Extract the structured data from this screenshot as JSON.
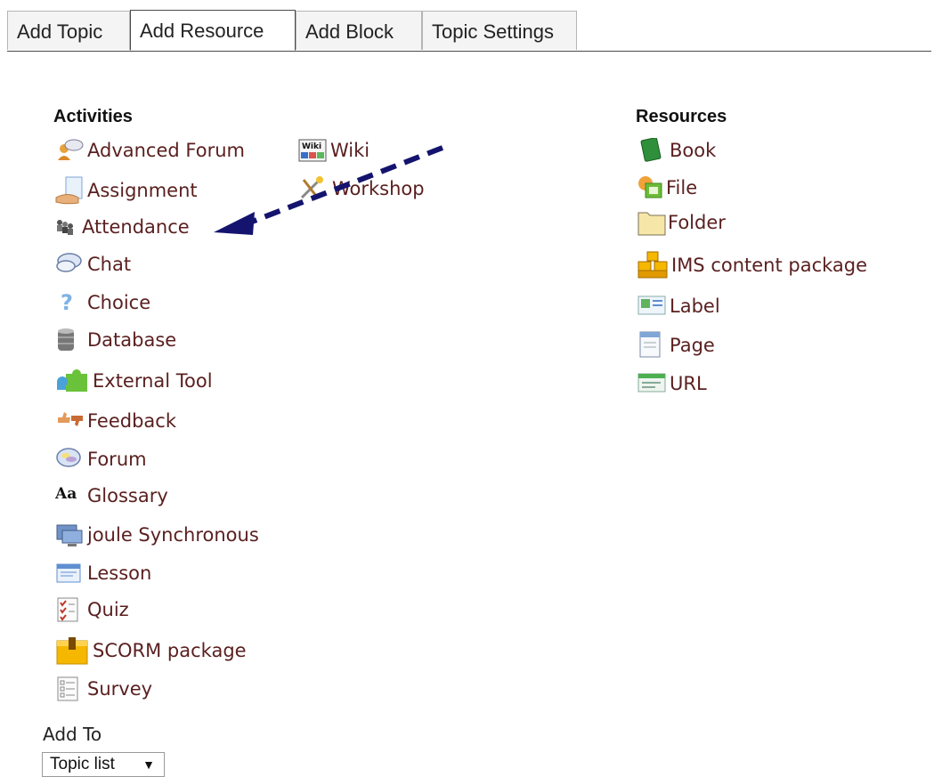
{
  "tabs": [
    {
      "label": "Add Topic"
    },
    {
      "label": "Add Resource"
    },
    {
      "label": "Add Block"
    },
    {
      "label": "Topic Settings"
    }
  ],
  "activities": {
    "heading": "Activities",
    "items": [
      {
        "label": "Advanced Forum",
        "icon": "advanced-forum-icon"
      },
      {
        "label": "Assignment",
        "icon": "assignment-icon"
      },
      {
        "label": "Attendance",
        "icon": "attendance-icon"
      },
      {
        "label": "Chat",
        "icon": "chat-icon"
      },
      {
        "label": "Choice",
        "icon": "question-icon"
      },
      {
        "label": "Database",
        "icon": "database-icon"
      },
      {
        "label": "External Tool",
        "icon": "puzzle-icon"
      },
      {
        "label": "Feedback",
        "icon": "thumbs-icon"
      },
      {
        "label": "Forum",
        "icon": "forum-icon"
      },
      {
        "label": "Glossary",
        "icon": "glossary-icon"
      },
      {
        "label": "joule Synchronous",
        "icon": "monitor-icon"
      },
      {
        "label": "Lesson",
        "icon": "lesson-icon"
      },
      {
        "label": "Quiz",
        "icon": "quiz-icon"
      },
      {
        "label": "SCORM package",
        "icon": "scorm-box-icon"
      },
      {
        "label": "Survey",
        "icon": "survey-icon"
      }
    ],
    "col2": [
      {
        "label": "Wiki",
        "icon": "wiki-icon"
      },
      {
        "label": "Workshop",
        "icon": "workshop-icon"
      }
    ]
  },
  "resources": {
    "heading": "Resources",
    "items": [
      {
        "label": "Book",
        "icon": "book-icon"
      },
      {
        "label": "File",
        "icon": "file-icon"
      },
      {
        "label": "Folder",
        "icon": "folder-icon"
      },
      {
        "label": "IMS content package",
        "icon": "ims-package-icon"
      },
      {
        "label": "Label",
        "icon": "label-icon"
      },
      {
        "label": "Page",
        "icon": "page-icon"
      },
      {
        "label": "URL",
        "icon": "url-icon"
      }
    ]
  },
  "add_to": {
    "label": "Add To",
    "selected": "Topic list",
    "caret": "▼"
  },
  "colors": {
    "link": "#5a1f1f",
    "arrow": "#14146e"
  }
}
